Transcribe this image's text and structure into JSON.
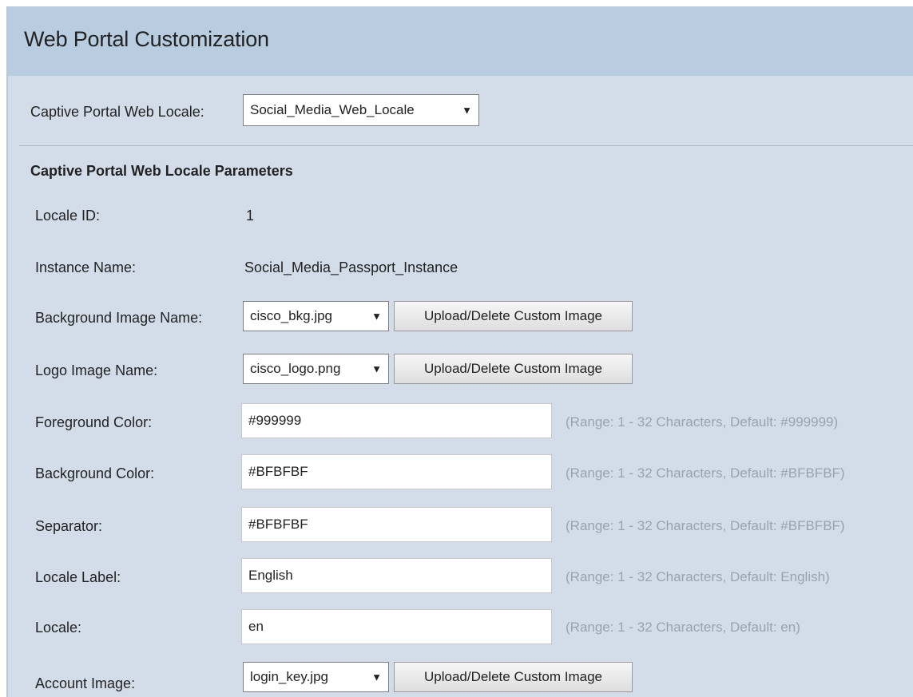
{
  "page": {
    "title": "Web Portal Customization"
  },
  "locale_selector": {
    "label": "Captive Portal Web Locale:",
    "selected": "Social_Media_Web_Locale"
  },
  "section": {
    "heading": "Captive Portal Web Locale Parameters"
  },
  "fields": {
    "locale_id": {
      "label": "Locale ID:",
      "value": "1"
    },
    "instance_name": {
      "label": "Instance Name:",
      "value": "Social_Media_Passport_Instance"
    },
    "background_image": {
      "label": "Background Image Name:",
      "selected": "cisco_bkg.jpg",
      "button": "Upload/Delete Custom Image"
    },
    "logo_image": {
      "label": "Logo Image Name:",
      "selected": "cisco_logo.png",
      "button": "Upload/Delete Custom Image"
    },
    "foreground_color": {
      "label": "Foreground Color:",
      "value": "#999999",
      "hint": "(Range: 1 - 32 Characters, Default: #999999)"
    },
    "background_color": {
      "label": "Background Color:",
      "value": "#BFBFBF",
      "hint": "(Range: 1 - 32 Characters, Default: #BFBFBF)"
    },
    "separator": {
      "label": "Separator:",
      "value": "#BFBFBF",
      "hint": "(Range: 1 - 32 Characters, Default: #BFBFBF)"
    },
    "locale_label": {
      "label": "Locale Label:",
      "value": "English",
      "hint": "(Range: 1 - 32 Characters, Default: English)"
    },
    "locale": {
      "label": "Locale:",
      "value": "en",
      "hint": "(Range: 1 - 32 Characters, Default: en)"
    },
    "account_image": {
      "label": "Account Image:",
      "selected": "login_key.jpg",
      "button": "Upload/Delete Custom Image"
    }
  },
  "icons": {
    "dropdown_arrow": "triangle-down-icon"
  },
  "colors": {
    "title_bar": "#b9cde0",
    "panel": "#d3dde9",
    "hint_text": "#9aa3ad"
  }
}
